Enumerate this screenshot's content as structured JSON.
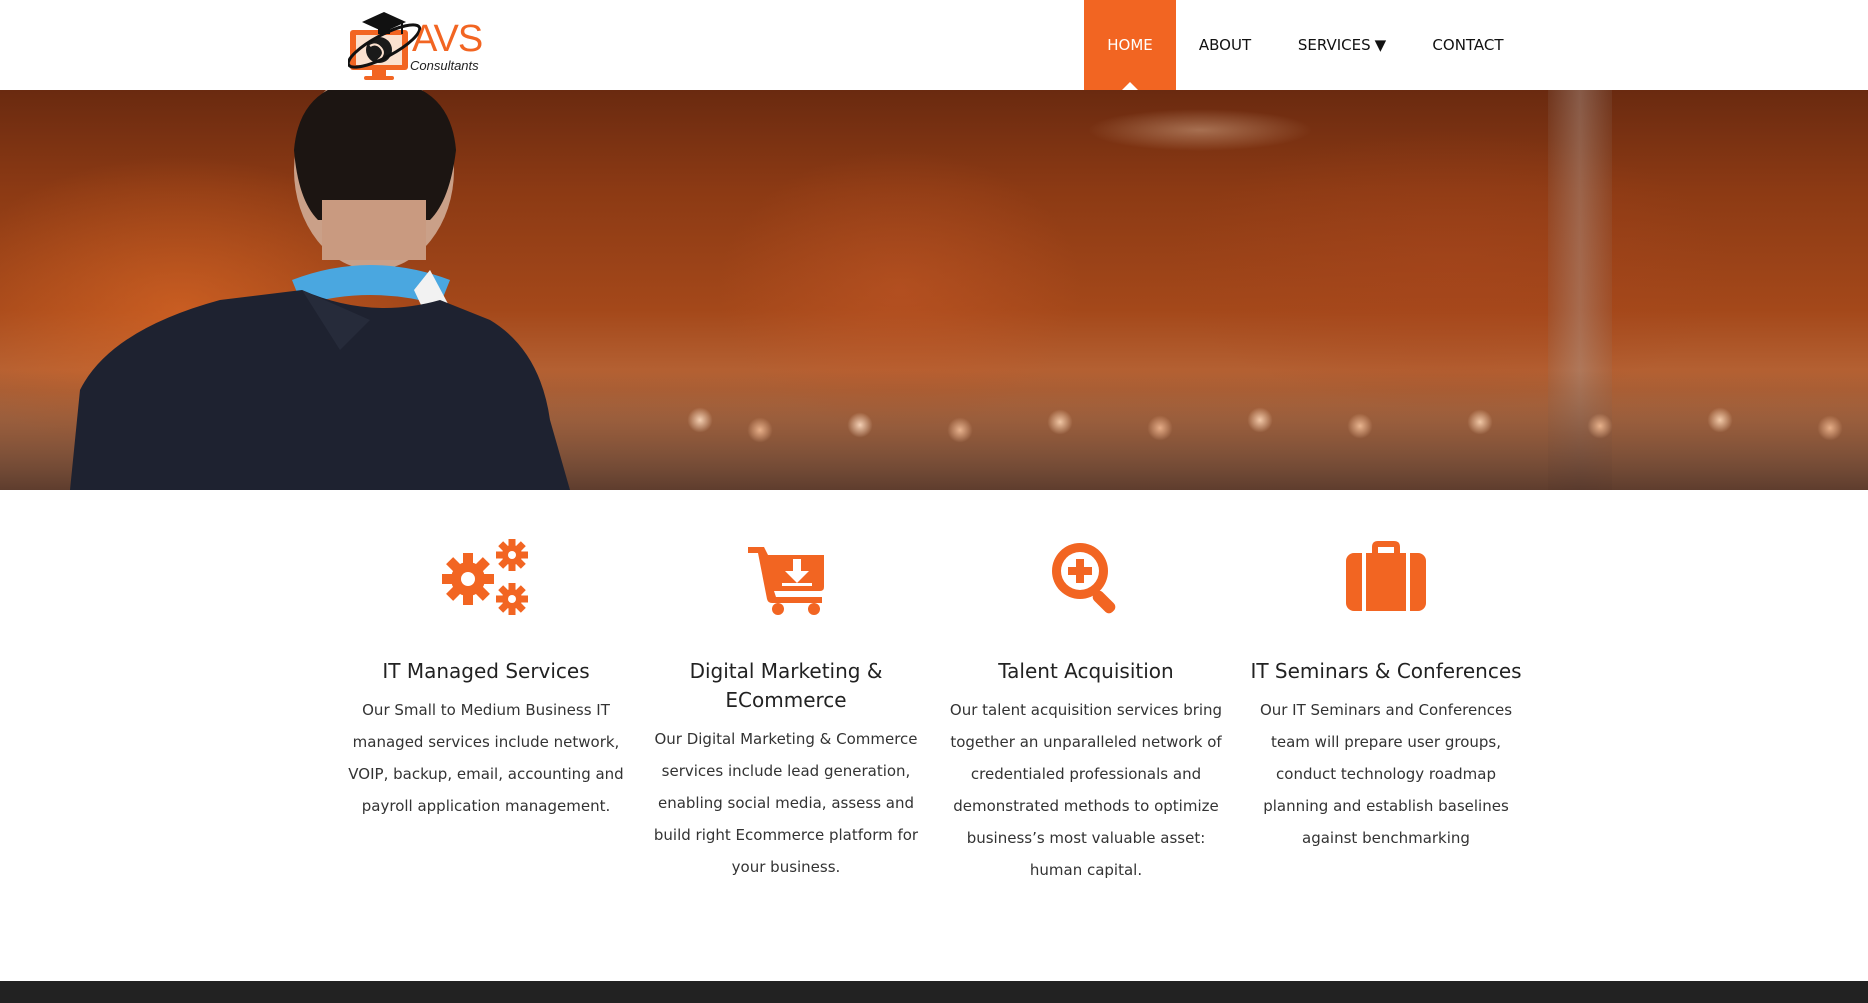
{
  "brand": {
    "logo_text": "AVS",
    "logo_subtext": "Consultants",
    "accent_color": "#f26522"
  },
  "nav": {
    "items": [
      {
        "label": "HOME",
        "active": true
      },
      {
        "label": "ABOUT",
        "active": false
      },
      {
        "label": "SERVICES",
        "active": false,
        "has_dropdown": true,
        "dropdown_icon": "triangle-down-icon"
      },
      {
        "label": "CONTACT",
        "active": false
      }
    ],
    "dropdown_glyph": "▼"
  },
  "hero": {
    "image": "speaker-addressing-audience-photo"
  },
  "services": [
    {
      "icon": "gears-icon",
      "title": "IT Managed Services",
      "description": "Our Small to Medium Business IT managed services include network, VOIP, backup, email, accounting and payroll application management."
    },
    {
      "icon": "shopping-cart-download-icon",
      "title": "Digital Marketing & ECommerce",
      "description": "Our Digital Marketing & Commerce services include lead generation, enabling social media, assess and build right Ecommerce platform for your business."
    },
    {
      "icon": "magnifier-plus-icon",
      "title": "Talent Acquisition",
      "description": "Our talent acquisition services bring together an unparalleled network of credentialed professionals and demonstrated methods to optimize business’s most valuable asset: human capital."
    },
    {
      "icon": "briefcase-icon",
      "title": "IT Seminars & Conferences",
      "description": "Our IT Seminars and Conferences team will prepare user groups, conduct technology roadmap planning and establish baselines against benchmarking"
    }
  ]
}
